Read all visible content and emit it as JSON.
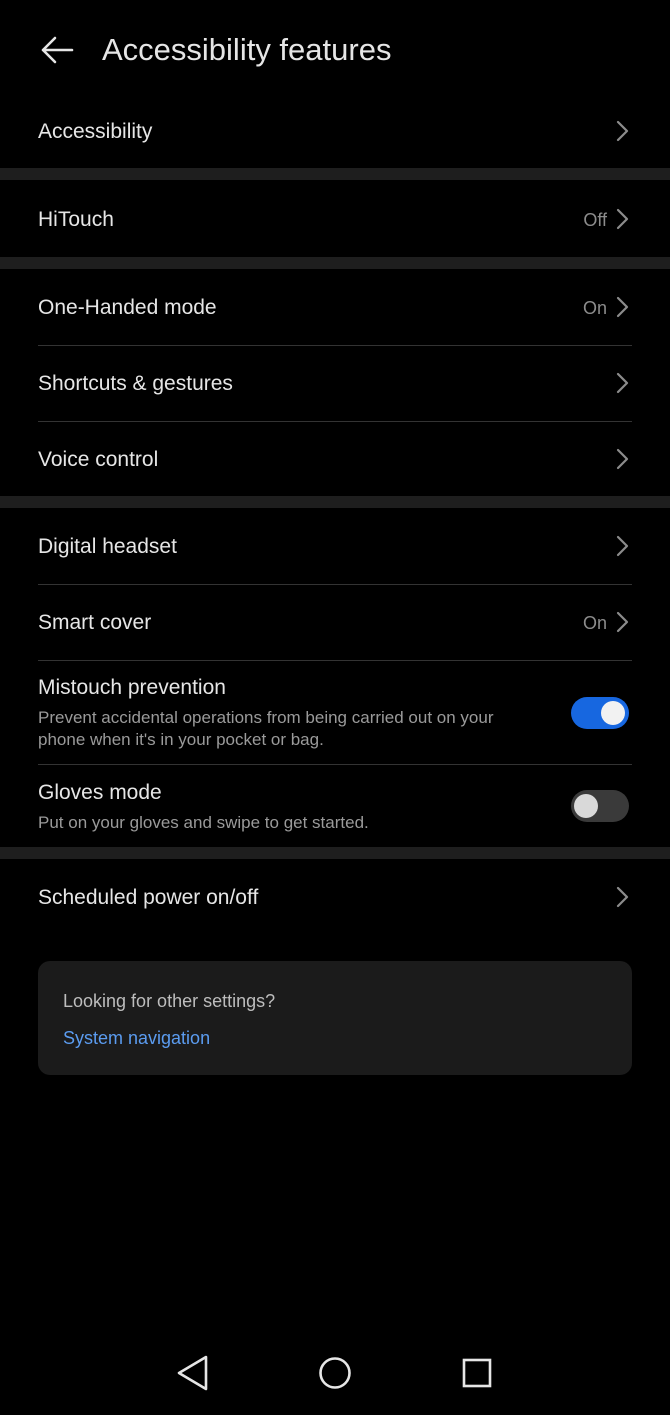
{
  "header": {
    "title": "Accessibility features",
    "back_icon": "arrow-left-icon"
  },
  "rows": {
    "accessibility": {
      "label": "Accessibility"
    },
    "hitouch": {
      "label": "HiTouch",
      "value": "Off"
    },
    "one_handed": {
      "label": "One-Handed mode",
      "value": "On"
    },
    "shortcuts": {
      "label": "Shortcuts & gestures"
    },
    "voice_control": {
      "label": "Voice control"
    },
    "digital_headset": {
      "label": "Digital headset"
    },
    "smart_cover": {
      "label": "Smart cover",
      "value": "On"
    },
    "mistouch": {
      "label": "Mistouch prevention",
      "description_line1": "Prevent accidental operations from being carried out on your",
      "description_line2": "phone when it's in your pocket or bag.",
      "enabled": true
    },
    "gloves": {
      "label": "Gloves mode",
      "description": "Put on your gloves and swipe to get started.",
      "enabled": false
    },
    "scheduled_power": {
      "label": "Scheduled power on/off"
    }
  },
  "card": {
    "question": "Looking for other settings?",
    "link": "System navigation"
  },
  "navbar": {
    "back_icon": "nav-back-icon",
    "home_icon": "nav-home-icon",
    "recents_icon": "nav-recents-icon"
  },
  "colors": {
    "background": "#000000",
    "separator": "#1e1e1e",
    "accent": "#1767e0",
    "link": "#5b9cf0",
    "card": "#1b1b1b"
  }
}
